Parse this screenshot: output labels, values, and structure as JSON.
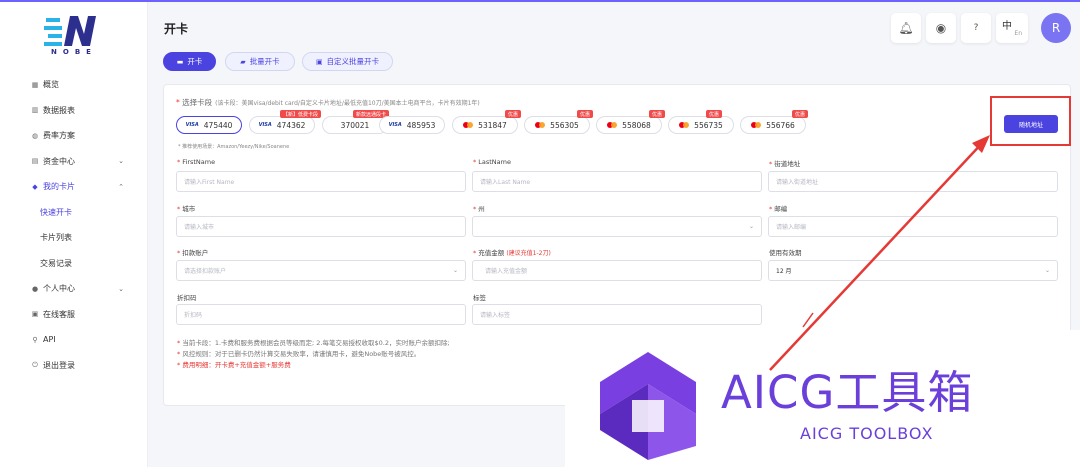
{
  "app": {
    "logo_text": "NOBE",
    "page_title": "开卡",
    "avatar_letter": "R",
    "lang_zh": "中",
    "lang_en": "En"
  },
  "header_icons": [
    "bell-icon",
    "chat-icon",
    "help-icon",
    "language-switch-icon"
  ],
  "sidebar": {
    "items": [
      {
        "label": "概览",
        "icon": "chart-icon"
      },
      {
        "label": "数据报表",
        "icon": "report-icon"
      },
      {
        "label": "费率方案",
        "icon": "rate-icon"
      },
      {
        "label": "资金中心",
        "icon": "wallet-icon",
        "chevron": "⌄"
      },
      {
        "label": "我的卡片",
        "icon": "card-icon",
        "chevron": "⌃"
      },
      {
        "label": "个人中心",
        "icon": "user-icon",
        "chevron": "⌄"
      },
      {
        "label": "在线客服",
        "icon": "support-icon"
      },
      {
        "label": "API",
        "icon": "api-icon"
      },
      {
        "label": "退出登录",
        "icon": "logout-icon"
      }
    ],
    "sub_items": [
      {
        "label": "快速开卡"
      },
      {
        "label": "卡片列表"
      },
      {
        "label": "交易记录"
      }
    ]
  },
  "tabs": [
    {
      "label": "开卡"
    },
    {
      "label": "批量开卡"
    },
    {
      "label": "自定义批量开卡"
    }
  ],
  "segment": {
    "label": "选择卡段",
    "hint": "(该卡段：美国visa/debit card/自定义卡片地址/最低充值10刀/美国本土电商平台，卡片有效期1年)",
    "items": [
      {
        "brand": "VISA",
        "number": "475440"
      },
      {
        "brand": "VISA",
        "number": "474362",
        "tag": "【新】低费卡段"
      },
      {
        "brand": "",
        "number": "370021",
        "tag": "新款远通段卡"
      },
      {
        "brand": "VISA",
        "number": "485953"
      },
      {
        "brand": "MC",
        "number": "531847",
        "tag": "优惠"
      },
      {
        "brand": "MC",
        "number": "556305",
        "tag": "优惠"
      },
      {
        "brand": "MC",
        "number": "558068",
        "tag": "优惠"
      },
      {
        "brand": "MC",
        "number": "556735",
        "tag": "优惠"
      },
      {
        "brand": "MC",
        "number": "556766",
        "tag": "优惠"
      }
    ],
    "scenarios": "* 推荐使用场景：Amazon/Yeezy/Nike/Soanene",
    "random_button": "随机地址"
  },
  "form": {
    "firstname": {
      "label": "FirstName",
      "placeholder": "请输入First Name"
    },
    "lastname": {
      "label": "LastName",
      "placeholder": "请输入Last Name"
    },
    "street": {
      "label": "街道地址",
      "placeholder": "请输入街道地址"
    },
    "city": {
      "label": "城市",
      "placeholder": "请输入城市"
    },
    "state": {
      "label": "州",
      "placeholder": ""
    },
    "zip": {
      "label": "邮编",
      "placeholder": "请输入邮编"
    },
    "account": {
      "label": "扣款账户",
      "placeholder": "请选择扣款账户"
    },
    "amount": {
      "label": "充值金额",
      "sub": "(建议充值1-2刀)",
      "placeholder": "请输入充值金额"
    },
    "validity": {
      "label": "使用有效期",
      "value": "12 月"
    },
    "discount": {
      "label": "折扣码",
      "placeholder": "折扣码"
    },
    "tag": {
      "label": "标签",
      "placeholder": "请输入标签"
    }
  },
  "notes": [
    "当前卡段：1.卡费和服务费根据会员等级而定; 2.每笔交易授权收取$0.2，实时账户余额扣除;",
    "风控规则：对于已删卡仍然计算交易失败率，请谨慎用卡，避免Nobe账号被风控。",
    "费用明细：开卡费+充值金额+服务费"
  ],
  "watermark": {
    "title": "AICG工具箱",
    "subtitle": "AICG TOOLBOX"
  },
  "colors": {
    "accent": "#4b43e0",
    "danger": "#e53935",
    "watermark": "#6b3fd9"
  }
}
